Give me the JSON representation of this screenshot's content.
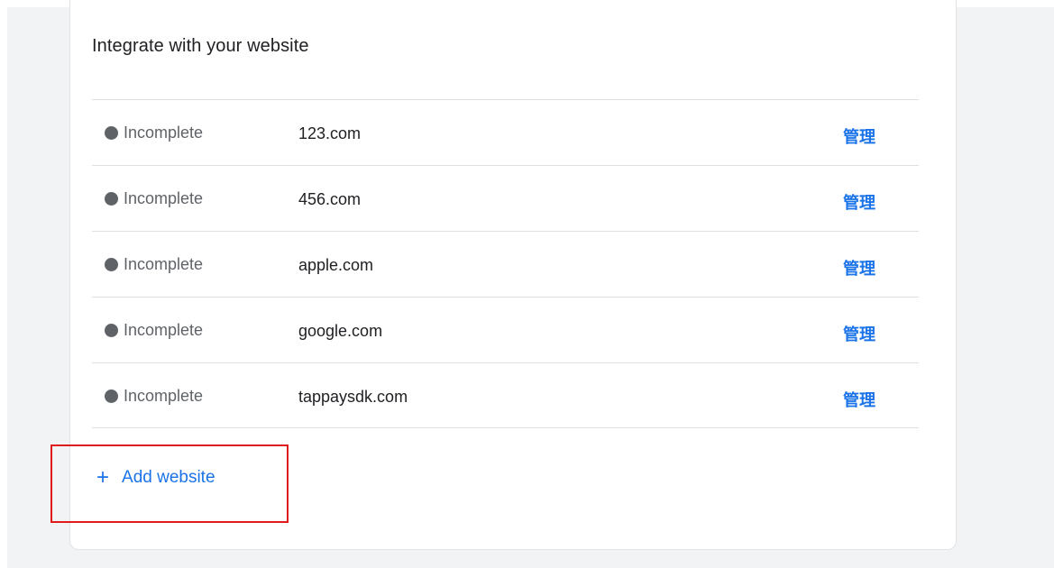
{
  "card": {
    "title": "Integrate with your website"
  },
  "websites": [
    {
      "status": "Incomplete",
      "domain": "123.com",
      "action": "管理"
    },
    {
      "status": "Incomplete",
      "domain": "456.com",
      "action": "管理"
    },
    {
      "status": "Incomplete",
      "domain": "apple.com",
      "action": "管理"
    },
    {
      "status": "Incomplete",
      "domain": "google.com",
      "action": "管理"
    },
    {
      "status": "Incomplete",
      "domain": "tappaysdk.com",
      "action": "管理"
    }
  ],
  "add_website": {
    "icon": "plus-icon",
    "symbol": "+",
    "label": "Add website"
  },
  "colors": {
    "accent": "#1a73e8",
    "status_incomplete": "#5f6368",
    "highlight": "#e01b1b"
  }
}
